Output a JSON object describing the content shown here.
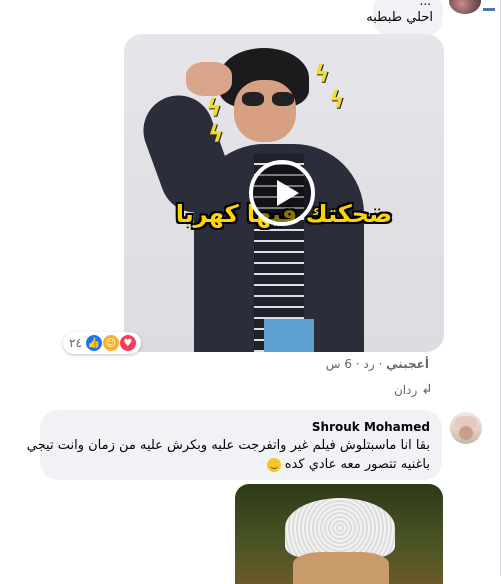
{
  "comment_top": {
    "text": "احلي طبطبه",
    "fragment": "..."
  },
  "video": {
    "caption": "ضحكتك فيها كهربا",
    "play_icon": "play-icon"
  },
  "reactions": {
    "count": "٢٤",
    "icons": [
      "love-icon",
      "care-icon",
      "like-icon"
    ]
  },
  "actions": {
    "like": "أعجبني",
    "separator": "·",
    "reply": "رد",
    "time": "6 س"
  },
  "replies": {
    "label": "ردان",
    "icon": "reply-arrow-icon"
  },
  "comment2": {
    "author": "Shrouk Mohamed",
    "line1": "بقا انا ماسبتلوش فيلم غير واتفرجت عليه وبكرش عليه من زمان وانت تيجي",
    "line2": "باغنيه تتصور معه عادي كده",
    "emoji": "smile-emoji-icon"
  },
  "colors": {
    "bubble": "#f0f2f5",
    "meta_text": "#65676b",
    "like_blue": "#1877f2",
    "love_red": "#f33e58",
    "caption_yellow": "#ffd400"
  }
}
